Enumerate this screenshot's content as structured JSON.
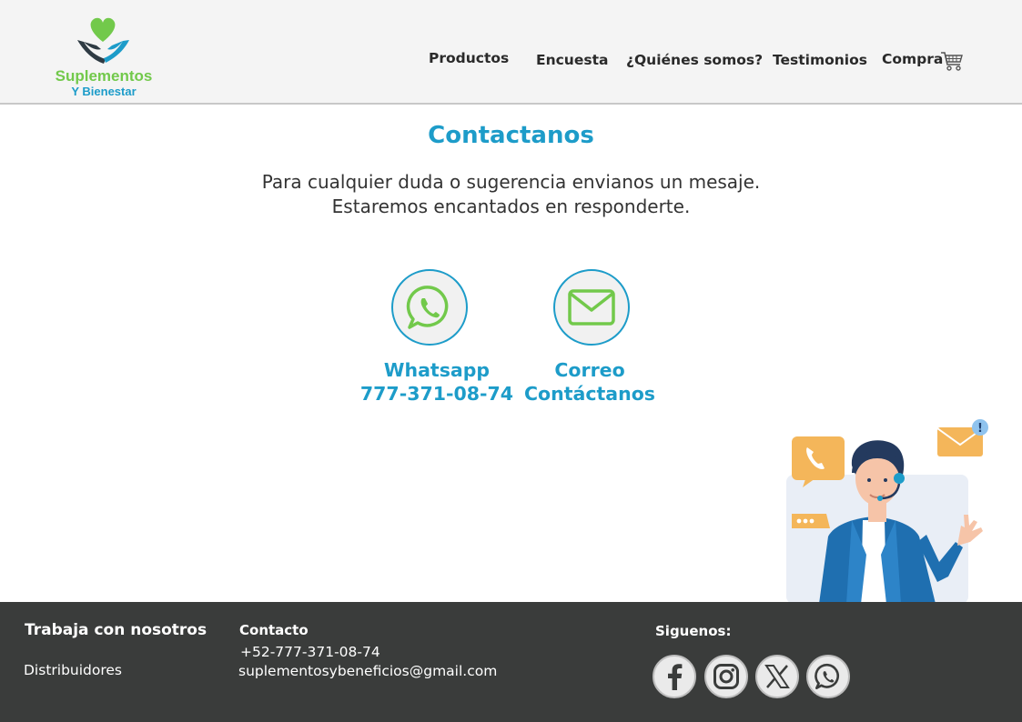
{
  "brand": {
    "name": "Suplementos",
    "sub": "Y Bienestar",
    "colors": {
      "green": "#72c94b",
      "blue": "#1d9cc9",
      "dark": "#2e3a43"
    }
  },
  "nav": {
    "items": [
      "Productos",
      "Encuesta",
      "¿Quiénes somos?",
      "Testimonios",
      "Compra"
    ],
    "cart_icon": "shopping-cart-icon"
  },
  "contact": {
    "title": "Contactanos",
    "line1": "Para cualquier duda o sugerencia envianos un mesaje.",
    "line2": "Estaremos encantados en responderte.",
    "cards": [
      {
        "icon": "whatsapp-icon",
        "label": "Whatsapp",
        "value": "777-371-08-74"
      },
      {
        "icon": "mail-icon",
        "label": "Correo",
        "value": "Contáctanos"
      }
    ]
  },
  "illustration": {
    "icon": "customer-support-agent-illustration"
  },
  "footer": {
    "work_heading": "Trabaja con nosotros",
    "work_link": "Distribuidores",
    "contact_heading": "Contacto",
    "phone": "+52-777-371-08-74",
    "email": "suplementosybeneficios@gmail.com",
    "follow_heading": "Siguenos:",
    "social": [
      "facebook-icon",
      "instagram-icon",
      "x-icon",
      "whatsapp-icon"
    ]
  }
}
